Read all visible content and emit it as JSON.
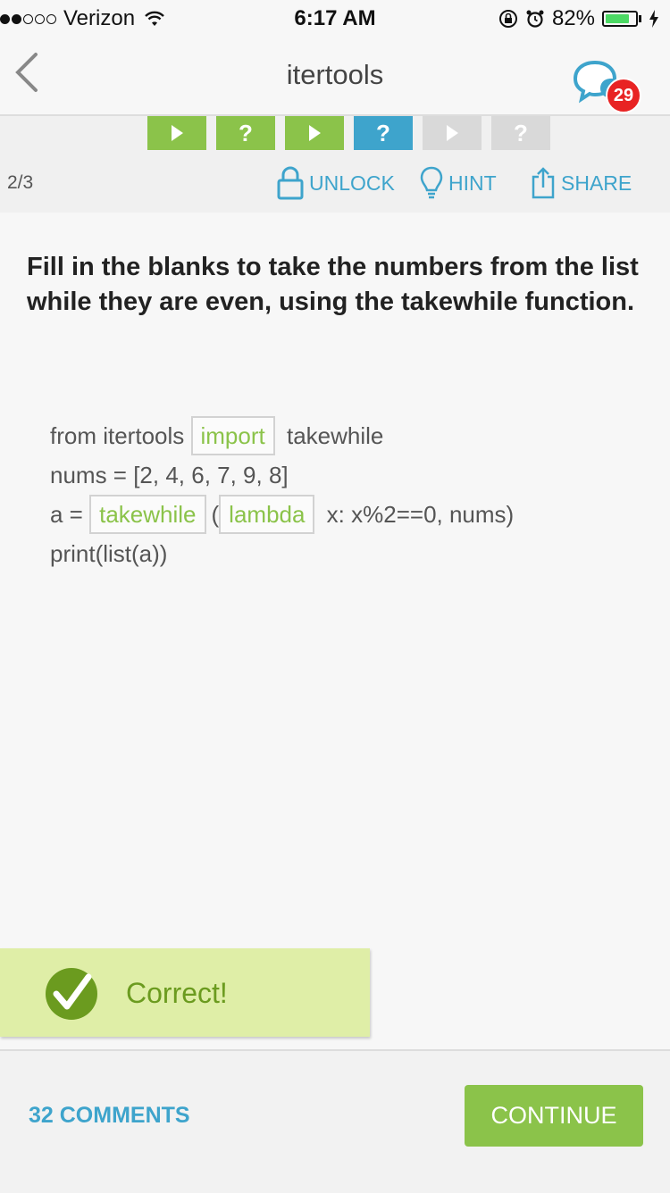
{
  "status_bar": {
    "carrier": "Verizon",
    "time": "6:17 AM",
    "battery": "82%",
    "battery_level": 0.82,
    "signal_bars_filled": 2,
    "signal_bars_total": 5
  },
  "nav": {
    "title": "itertools",
    "back_icon": "chevron-left-icon",
    "chat_icon": "chat-bubbles-icon",
    "notification_count": "29"
  },
  "progress_steps": [
    {
      "type": "play",
      "state": "completed",
      "label": ""
    },
    {
      "type": "quiz",
      "state": "completed",
      "label": "?"
    },
    {
      "type": "play",
      "state": "completed",
      "label": ""
    },
    {
      "type": "quiz",
      "state": "current",
      "label": "?"
    },
    {
      "type": "play",
      "state": "locked",
      "label": ""
    },
    {
      "type": "quiz",
      "state": "locked",
      "label": "?"
    }
  ],
  "toolbar": {
    "counter": "2/3",
    "unlock_label": "UNLOCK",
    "hint_label": "HINT",
    "share_label": "SHARE"
  },
  "question": "Fill in the blanks to take the numbers from the list while they are even, using the takewhile function.",
  "code": {
    "line1_pre": "from itertools ",
    "line1_blank": "import",
    "line1_post": " takewhile",
    "line2": "nums = [2, 4, 6, 7, 9, 8]",
    "line3_pre": "a = ",
    "line3_blank1": "takewhile",
    "line3_mid": "(",
    "line3_blank2": "lambda",
    "line3_post": " x: x%2==0, nums)",
    "line4": "print(list(a))"
  },
  "feedback": {
    "text": "Correct!",
    "icon": "checkmark-icon"
  },
  "footer": {
    "comments_label": "32 COMMENTS",
    "continue_label": "CONTINUE"
  },
  "colors": {
    "accent_green": "#8bc34a",
    "accent_blue": "#3ea4cc",
    "badge_red": "#e82323",
    "feedback_bg": "#dfeea7"
  }
}
